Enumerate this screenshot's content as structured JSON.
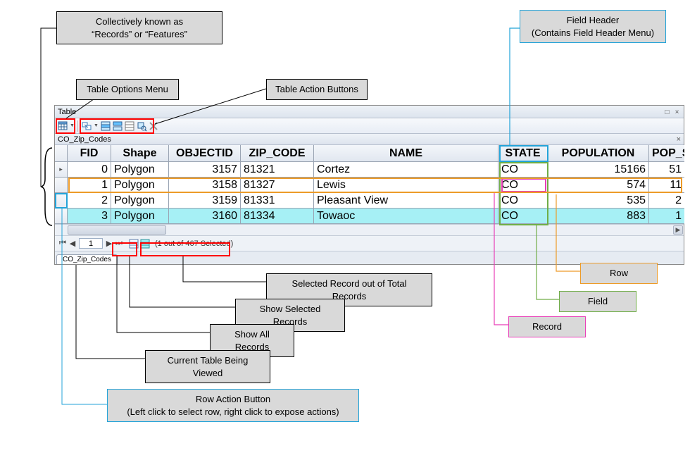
{
  "window": {
    "title": "Table",
    "subtitle": "CO_Zip_Codes",
    "tab_label": "CO_Zip_Codes"
  },
  "columns": {
    "fid": "FID",
    "shape": "Shape",
    "objectid": "OBJECTID",
    "zip": "ZIP_CODE",
    "name": "NAME",
    "state": "STATE",
    "pop": "POPULATION",
    "sq": "POP_SQ"
  },
  "rows": [
    {
      "fid": "0",
      "shape": "Polygon",
      "objectid": "3157",
      "zip": "81321",
      "name": "Cortez",
      "state": "CO",
      "pop": "15166",
      "sq": "51",
      "selected": false
    },
    {
      "fid": "1",
      "shape": "Polygon",
      "objectid": "3158",
      "zip": "81327",
      "name": "Lewis",
      "state": "CO",
      "pop": "574",
      "sq": "11",
      "selected": false
    },
    {
      "fid": "2",
      "shape": "Polygon",
      "objectid": "3159",
      "zip": "81331",
      "name": "Pleasant View",
      "state": "CO",
      "pop": "535",
      "sq": "2",
      "selected": false
    },
    {
      "fid": "3",
      "shape": "Polygon",
      "objectid": "3160",
      "zip": "81334",
      "name": "Towaoc",
      "state": "CO",
      "pop": "883",
      "sq": "1",
      "selected": true
    }
  ],
  "nav": {
    "page": "1",
    "status": "(1 out of 467 Selected)"
  },
  "callouts": {
    "records": "Collectively known as\n“Records” or “Features”",
    "table_options": "Table Options Menu",
    "action_buttons": "Table Action Buttons",
    "field_header": "Field Header\n(Contains Field Header Menu)",
    "row": "Row",
    "field": "Field",
    "record": "Record",
    "selected_count": "Selected Record out of Total Records",
    "show_selected": "Show Selected Records",
    "show_all": "Show All Records",
    "current_table": "Current Table Being Viewed",
    "row_action": "Row Action Button\n(Left click to select row, right click to expose actions)"
  }
}
